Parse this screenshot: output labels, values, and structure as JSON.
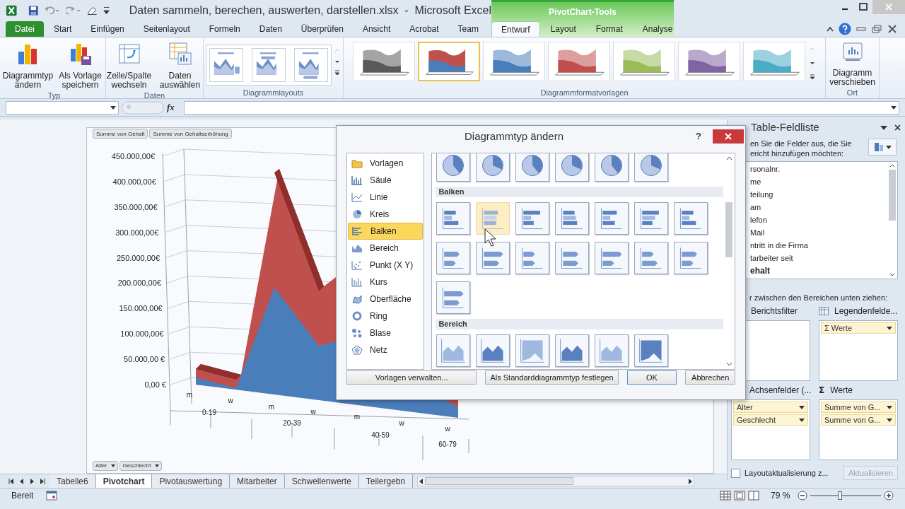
{
  "window": {
    "title": "Daten sammeln, berechen, auswerten, darstellen.xlsx  -  Microsoft Excel"
  },
  "context_group": {
    "label": "PivotChart-Tools"
  },
  "tabs": [
    {
      "label": "Datei",
      "kind": "file",
      "selected": false
    },
    {
      "label": "Start",
      "kind": "normal",
      "selected": false
    },
    {
      "label": "Einfügen",
      "kind": "normal",
      "selected": false
    },
    {
      "label": "Seitenlayout",
      "kind": "normal",
      "selected": false
    },
    {
      "label": "Formeln",
      "kind": "normal",
      "selected": false
    },
    {
      "label": "Daten",
      "kind": "normal",
      "selected": false
    },
    {
      "label": "Überprüfen",
      "kind": "normal",
      "selected": false
    },
    {
      "label": "Ansicht",
      "kind": "normal",
      "selected": false
    },
    {
      "label": "Acrobat",
      "kind": "normal",
      "selected": false
    },
    {
      "label": "Team",
      "kind": "normal",
      "selected": false
    },
    {
      "label": "Entwurf",
      "kind": "context",
      "selected": true
    },
    {
      "label": "Layout",
      "kind": "context",
      "selected": false
    },
    {
      "label": "Format",
      "kind": "context",
      "selected": false
    },
    {
      "label": "Analyse",
      "kind": "context",
      "selected": false
    }
  ],
  "ribbon": {
    "type_group": {
      "label": "Typ",
      "buttons": [
        "Diagrammtyp ändern",
        "Als Vorlage speichern"
      ]
    },
    "data_group": {
      "label": "Daten",
      "buttons": [
        "Zeile/Spalte wechseln",
        "Daten auswählen"
      ]
    },
    "layouts_group": {
      "label": "Diagrammlayouts",
      "layouts": [
        {
          "kind": "legend-right"
        },
        {
          "kind": "legend-top"
        },
        {
          "kind": "legend-bottom"
        }
      ]
    },
    "styles_group": {
      "label": "Diagrammformatvorlagen",
      "styles": [
        {
          "color": "#595959",
          "selected": false
        },
        {
          "color": "#4a7ebb",
          "top_band": {
            "color": "#c0504d"
          },
          "selected": true
        },
        {
          "color": "#4a7ebb",
          "selected": false
        },
        {
          "color": "#c0504d",
          "selected": false
        },
        {
          "color": "#9bbb59",
          "selected": false
        },
        {
          "color": "#8064a2",
          "selected": false
        },
        {
          "color": "#4bacc6",
          "selected": false
        }
      ]
    },
    "location_group": {
      "label": "Ort",
      "button": "Diagramm verschieben"
    }
  },
  "formula_bar": {
    "fx": "fx"
  },
  "chart": {
    "value_buttons": [
      "Summe von Gehalt",
      "Summe von Gehaltserhöhung"
    ],
    "axis_buttons": [
      "Alter",
      "Geschlecht"
    ],
    "y_labels": [
      "450.000,00€",
      "400.000,00€",
      "350.000,00€",
      "300.000,00€",
      "250.000,00€",
      "200.000,00€",
      "150.000,00€",
      "100.000,00€",
      "50.000,00 €",
      "0,00 €"
    ],
    "x_labels": [
      "m",
      "w",
      "m",
      "w",
      "m",
      "w",
      "w"
    ],
    "x_groups": [
      "0-19",
      "20-39",
      "40-59",
      "60-79"
    ]
  },
  "dialog": {
    "title": "Diagrammtyp ändern",
    "help": "?",
    "categories": [
      {
        "label": "Vorlagen",
        "selected": false
      },
      {
        "label": "Säule",
        "selected": false
      },
      {
        "label": "Linie",
        "selected": false
      },
      {
        "label": "Kreis",
        "selected": false
      },
      {
        "label": "Balken",
        "selected": true
      },
      {
        "label": "Bereich",
        "selected": false
      },
      {
        "label": "Punkt (X Y)",
        "selected": false
      },
      {
        "label": "Kurs",
        "selected": false
      },
      {
        "label": "Oberfläche",
        "selected": false
      },
      {
        "label": "Ring",
        "selected": false
      },
      {
        "label": "Blase",
        "selected": false
      },
      {
        "label": "Netz",
        "selected": false
      }
    ],
    "sections": [
      {
        "kind": "pie",
        "items": [
          {
            "selected": false
          },
          {
            "selected": false
          },
          {
            "selected": false
          },
          {
            "selected": false
          },
          {
            "selected": false
          },
          {
            "selected": false
          }
        ]
      },
      {
        "kind": "bar",
        "title": "Balken",
        "items": [
          {
            "selected": false
          },
          {
            "selected": true
          },
          {
            "selected": false
          },
          {
            "selected": false
          },
          {
            "selected": false
          },
          {
            "selected": false
          },
          {
            "selected": false
          },
          {
            "selected": false
          },
          {
            "selected": false
          },
          {
            "selected": false
          },
          {
            "selected": false
          },
          {
            "selected": false
          },
          {
            "selected": false
          },
          {
            "selected": false
          },
          {
            "selected": false
          }
        ]
      },
      {
        "kind": "area",
        "title": "Bereich",
        "items": [
          {
            "selected": false
          },
          {
            "selected": false
          },
          {
            "selected": false
          },
          {
            "selected": false
          },
          {
            "selected": false
          },
          {
            "selected": false
          }
        ]
      }
    ],
    "buttons": [
      {
        "label": "Vorlagen verwalten...",
        "kind": "wide"
      },
      {
        "label": "Als Standarddiagrammtyp festlegen",
        "kind": "wide"
      },
      {
        "label": "OK",
        "kind": "default"
      },
      {
        "label": "Abbrechen",
        "kind": "normal"
      }
    ]
  },
  "field_list": {
    "title": "Table-Feldliste",
    "instruction_lines": [
      "en Sie die Felder aus, die Sie",
      "ericht hinzufügen möchten:"
    ],
    "fields": [
      {
        "label": "rsonalnr.",
        "active": false
      },
      {
        "label": "me",
        "active": false
      },
      {
        "label": "teilung",
        "active": false
      },
      {
        "label": "am",
        "active": false
      },
      {
        "label": "lefon",
        "active": false
      },
      {
        "label": "Mail",
        "active": false
      },
      {
        "label": "ntritt in die Firma",
        "active": false
      },
      {
        "label": "tarbeiter seit",
        "active": false
      },
      {
        "label": "ehalt",
        "active": true
      }
    ],
    "drag_hint": "r zwischen den Bereichen unten ziehen:",
    "filter_area": {
      "label": "Berichtsfilter"
    },
    "legend_area": {
      "label": "Legendenfelde...",
      "items": [
        "Σ Werte"
      ]
    },
    "axis_area": {
      "label": "Achsenfelder (...",
      "items": [
        "Alter",
        "Geschlecht"
      ]
    },
    "values_area": {
      "label": "Werte",
      "symbol": "Σ",
      "items": [
        "Summe von G...",
        "Summe von G..."
      ]
    },
    "defer": {
      "label": "Layoutaktualisierung z...",
      "checked": false
    },
    "update_button": {
      "label": "Aktualisieren",
      "disabled": true
    }
  },
  "sheet_tabs": [
    {
      "label": "Tabelle6",
      "selected": false
    },
    {
      "label": "Pivotchart",
      "selected": true
    },
    {
      "label": "Pivotauswertung",
      "selected": false
    },
    {
      "label": "Mitarbeiter",
      "selected": false
    },
    {
      "label": "Schwellenwerte",
      "selected": false
    },
    {
      "label": "Teilergebn",
      "selected": false
    }
  ],
  "status_bar": {
    "mode": "Bereit",
    "zoom": "79 %",
    "zoom_slider": {
      "level": 0.42
    }
  }
}
